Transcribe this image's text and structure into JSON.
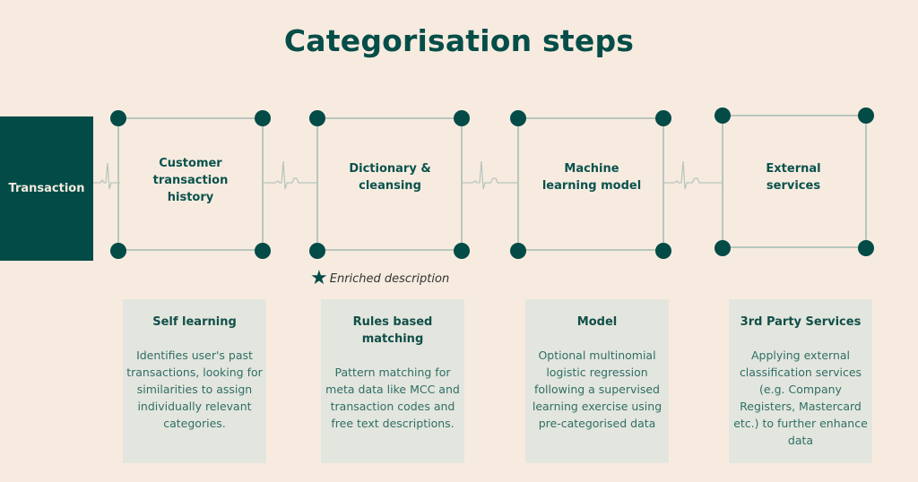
{
  "title": "Categorisation steps",
  "start_node": {
    "label": "Transaction"
  },
  "steps": [
    {
      "label": "Customer transaction history"
    },
    {
      "label": "Dictionary & cleansing"
    },
    {
      "label": "Machine learning model"
    },
    {
      "label": "External services"
    }
  ],
  "annotation": {
    "icon": "star-icon",
    "text": "Enriched description"
  },
  "cards": [
    {
      "title": "Self learning",
      "body": "Identifies user's past transactions, looking for similarities to assign individually relevant categories."
    },
    {
      "title": "Rules based matching",
      "body": "Pattern matching for meta data like MCC and transaction codes and free text descriptions."
    },
    {
      "title": "Model",
      "body": "Optional multinomial logistic regression following a supervised learning exercise using pre-categorised data"
    },
    {
      "title": "3rd Party Services",
      "body": "Applying external classification services (e.g. Company Registers, Mastercard etc.) to further enhance data"
    }
  ],
  "colors": {
    "accent": "#024b47",
    "background": "#f7ebe0",
    "card": "#e3e6de",
    "line": "#b8c6bd"
  }
}
